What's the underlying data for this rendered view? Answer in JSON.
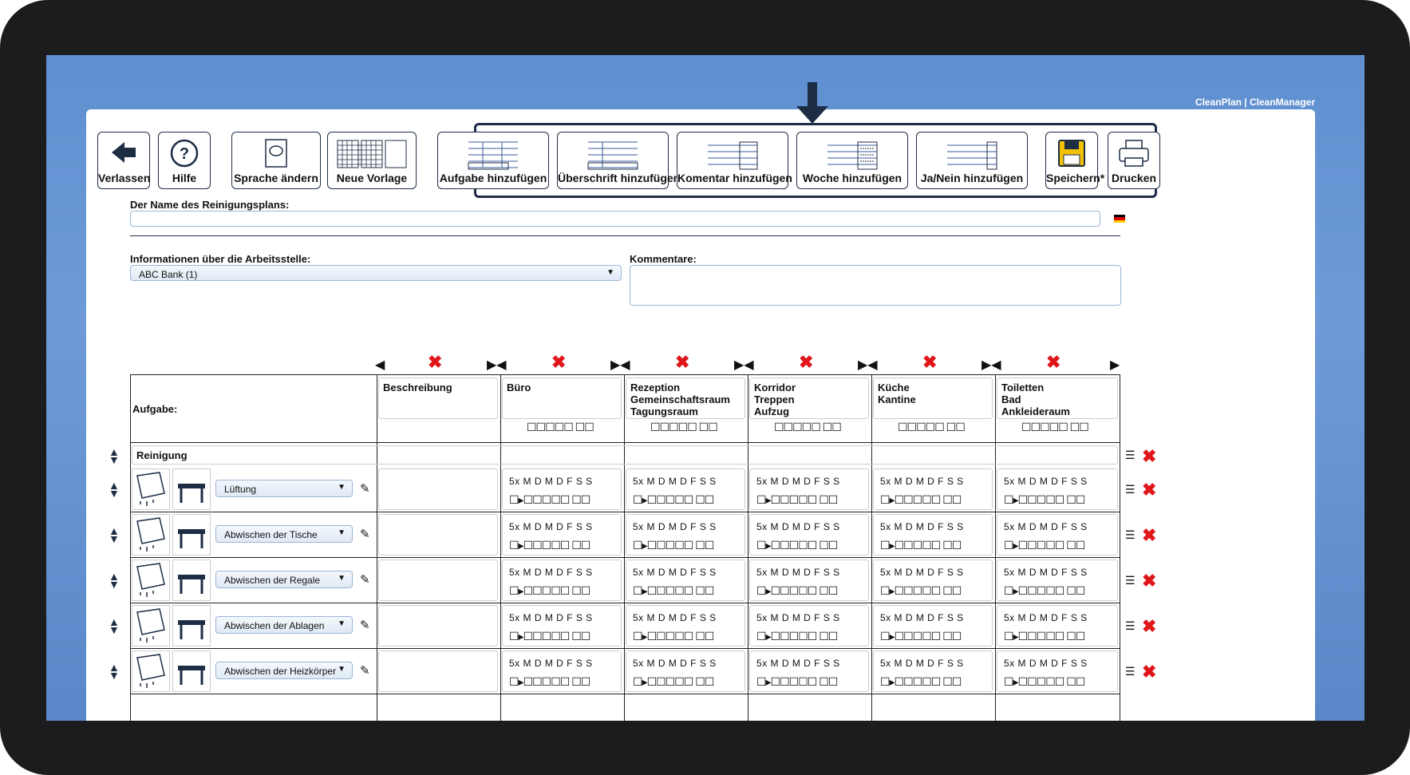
{
  "brand": "CleanPlan | CleanManager",
  "toolbar": {
    "exit": "Verlassen",
    "help": "Hilfe",
    "language": "Sprache ändern",
    "new_template": "Neue Vorlage",
    "add_task": "Aufgabe hinzufügen",
    "add_heading": "Überschrift hinzufügen",
    "add_comment": "Komentar hinzufügen",
    "add_week": "Woche hinzufügen",
    "add_yesno": "Ja/Nein hinzufügen",
    "save": "Speichern*",
    "print": "Drucken"
  },
  "form": {
    "plan_name_label": "Der Name des Reinigungsplans:",
    "plan_name_value": "",
    "workplace_label": "Informationen über die Arbeitsstelle:",
    "workplace_value": "ABC Bank (1)",
    "comments_label": "Kommentare:"
  },
  "table": {
    "task_header": "Aufgabe:",
    "description_header": "Beschreibung",
    "areas": [
      {
        "l1": "Büro",
        "l2": "",
        "l3": ""
      },
      {
        "l1": "Rezeption",
        "l2": "Gemeinschaftsraum",
        "l3": "Tagungsraum"
      },
      {
        "l1": "Korridor",
        "l2": "Treppen",
        "l3": "Aufzug"
      },
      {
        "l1": "Küche",
        "l2": "Kantine",
        "l3": ""
      },
      {
        "l1": "Toiletten",
        "l2": "Bad",
        "l3": "Ankleideraum"
      }
    ],
    "section_heading": "Reinigung",
    "schedule_label": "5x  M D M D F  S S",
    "tasks": [
      "Lüftung",
      "Abwischen der Tische",
      "Abwischen der Regale",
      "Abwischen der Ablagen",
      "Abwischen der Heizkörper"
    ]
  }
}
